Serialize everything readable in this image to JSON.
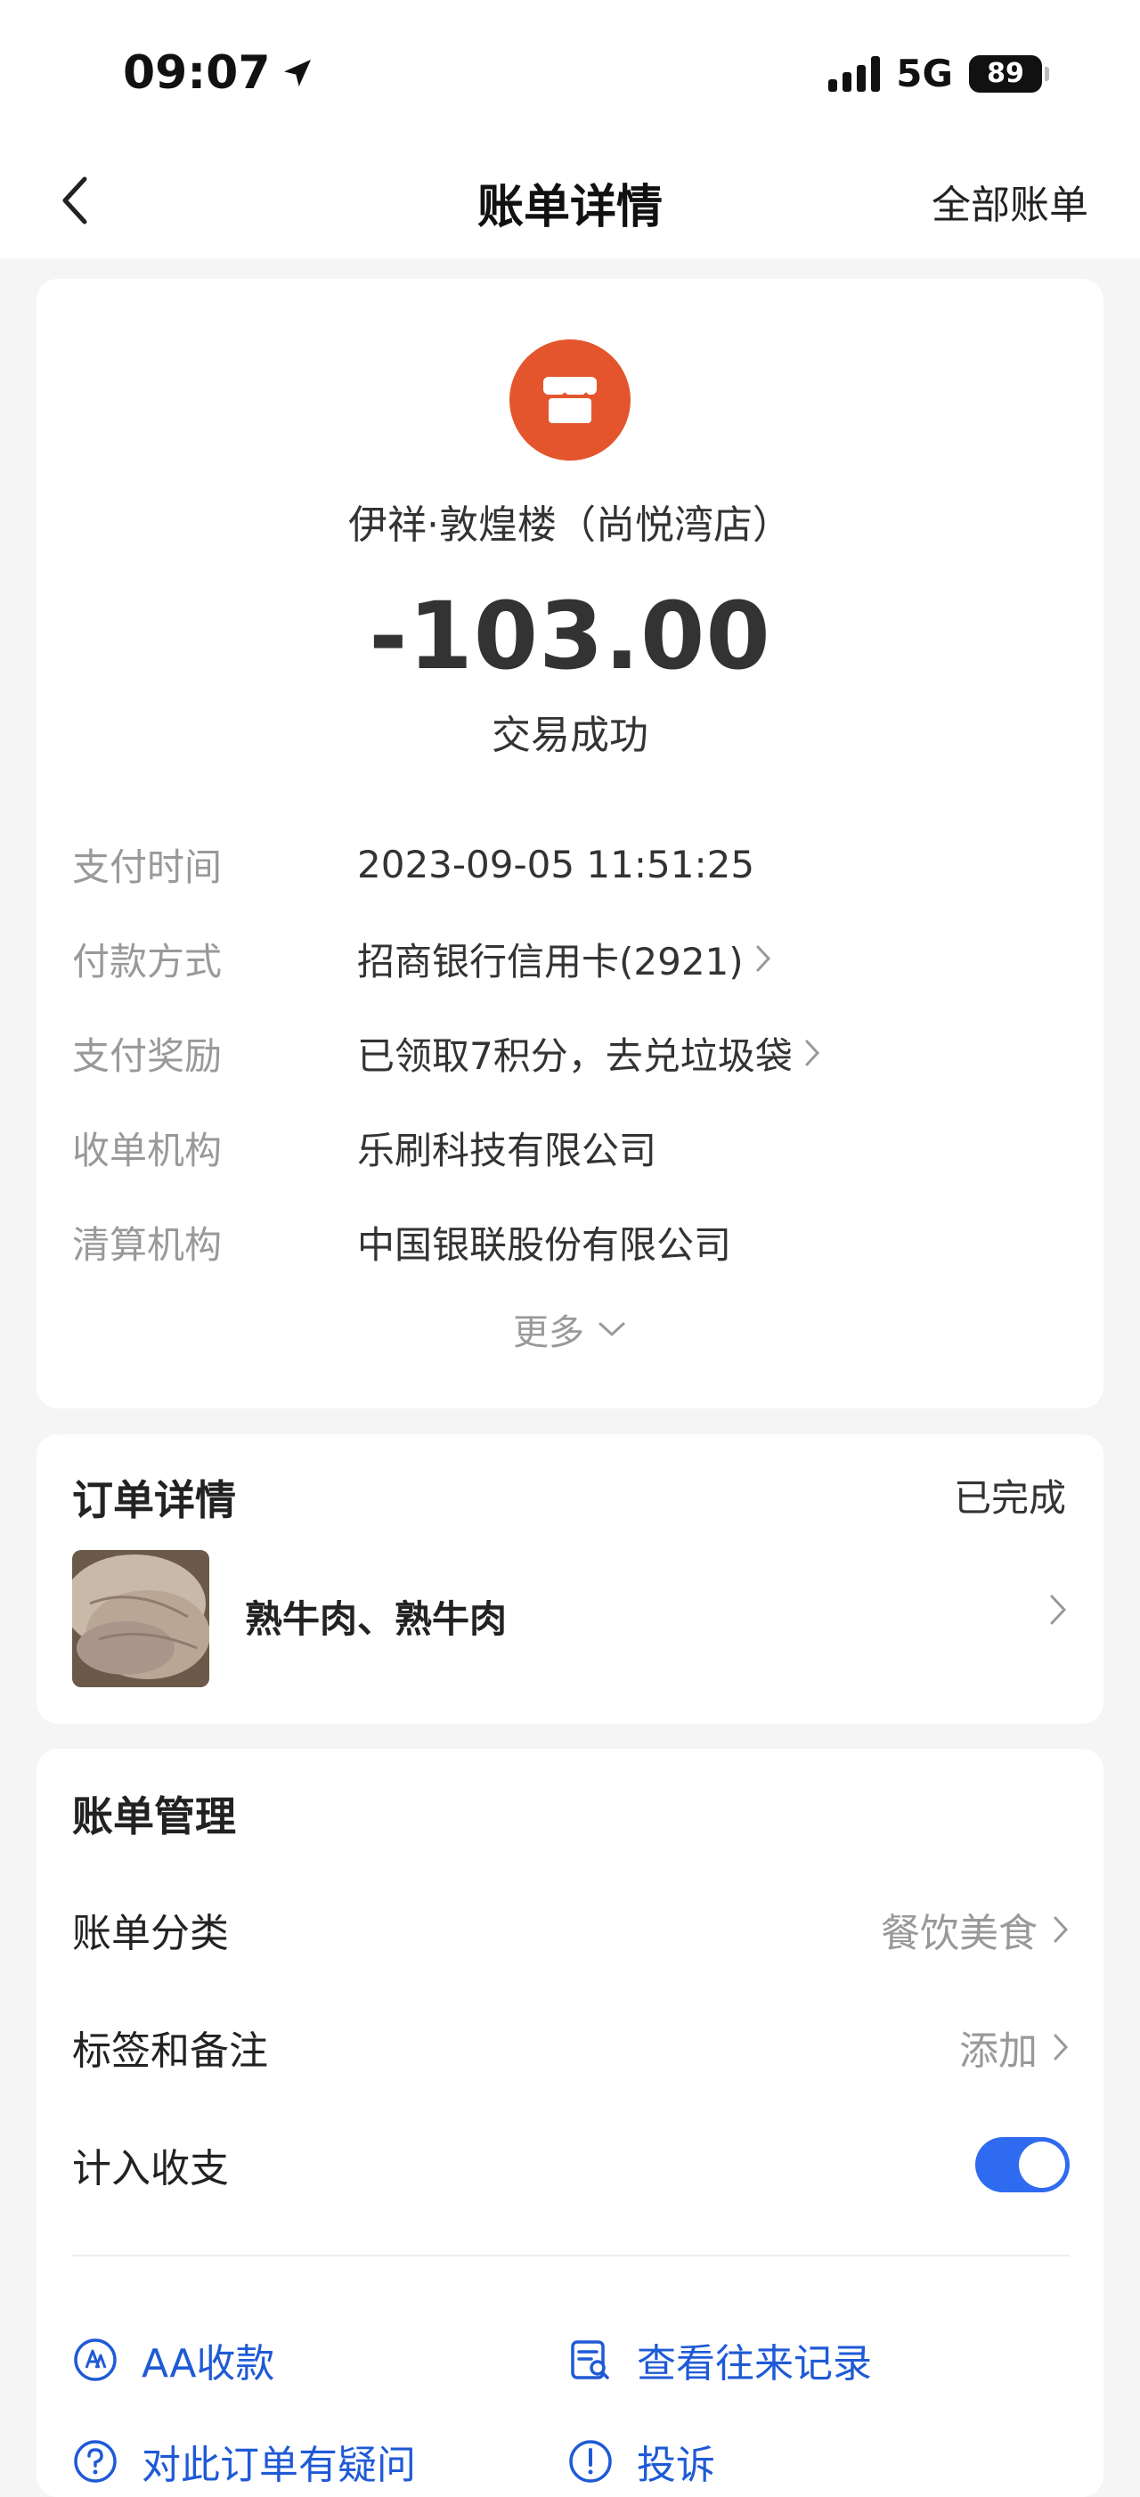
{
  "status_bar": {
    "time": "09:07",
    "network": "5G",
    "battery": "89"
  },
  "nav": {
    "title": "账单详情",
    "right_action": "全部账单"
  },
  "transaction": {
    "merchant": "伊祥·敦煌楼（尚悦湾店）",
    "amount": "-103.00",
    "status": "交易成功",
    "details": [
      {
        "label": "支付时间",
        "value": "2023-09-05 11:51:25"
      },
      {
        "label": "付款方式",
        "value": "招商银行信用卡(2921)"
      },
      {
        "label": "支付奖励",
        "value": "已领取7积分，去兑垃圾袋"
      },
      {
        "label": "收单机构",
        "value": "乐刷科技有限公司"
      },
      {
        "label": "清算机构",
        "value": "中国银联股份有限公司"
      }
    ],
    "more": "更多"
  },
  "order": {
    "title": "订单详情",
    "status": "已完成",
    "items": "熟牛肉、熟牛肉"
  },
  "manage": {
    "title": "账单管理",
    "category_label": "账单分类",
    "category_value": "餐饮美食",
    "tags_label": "标签和备注",
    "tags_value": "添加",
    "include_label": "计入收支",
    "include_on": true,
    "actions": {
      "aa": "AA收款",
      "history": "查看往来记录",
      "question": "对此订单有疑问",
      "complaint": "投诉"
    }
  },
  "colors": {
    "accent_blue": "#2f6bf0",
    "link_blue": "#1f5ad6",
    "shop_orange": "#e4552d",
    "label_gray": "#999999"
  }
}
